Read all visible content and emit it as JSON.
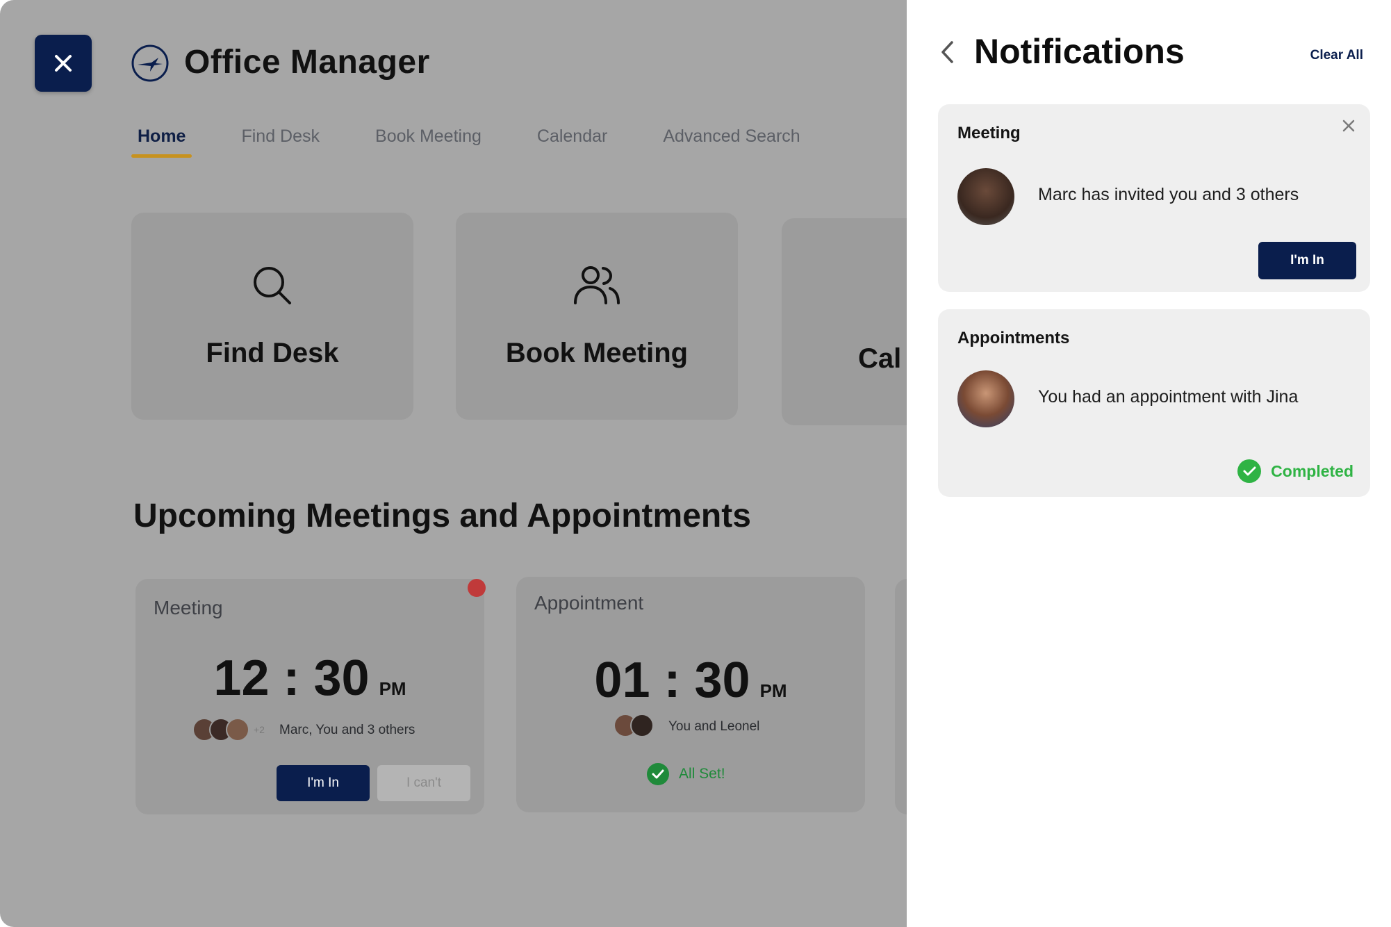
{
  "app": {
    "title": "Office Manager",
    "nav_tabs": [
      "Home",
      "Find Desk",
      "Book Meeting",
      "Calendar",
      "Advanced Search"
    ],
    "active_tab": "Home",
    "tiles": [
      {
        "label": "Find Desk",
        "icon": "search-icon"
      },
      {
        "label": "Book Meeting",
        "icon": "users-icon"
      },
      {
        "label": "Cal",
        "icon": "calendar-icon"
      }
    ],
    "section_title": "Upcoming Meetings and Appointments",
    "cards": [
      {
        "type": "Meeting",
        "time": "12 : 30",
        "ampm": "PM",
        "participants": "Marc, You and 3 others",
        "extra_count": "+2",
        "primary_label": "I'm In",
        "secondary_label": "I can't"
      },
      {
        "type": "Appointment",
        "time": "01 : 30",
        "ampm": "PM",
        "participants": "You and Leonel",
        "status": "All Set!"
      }
    ]
  },
  "notifications": {
    "title": "Notifications",
    "clear_all": "Clear All",
    "items": [
      {
        "title": "Meeting",
        "text": "Marc has invited you and 3 others",
        "action_label": "I'm In"
      },
      {
        "title": "Appointments",
        "text": "You had an appointment with Jina",
        "status": "Completed"
      }
    ]
  },
  "colors": {
    "navy": "#0a1e4d",
    "accent_gold": "#c7921f",
    "success_green": "#2fb344",
    "alert_red": "#c03a3a"
  }
}
